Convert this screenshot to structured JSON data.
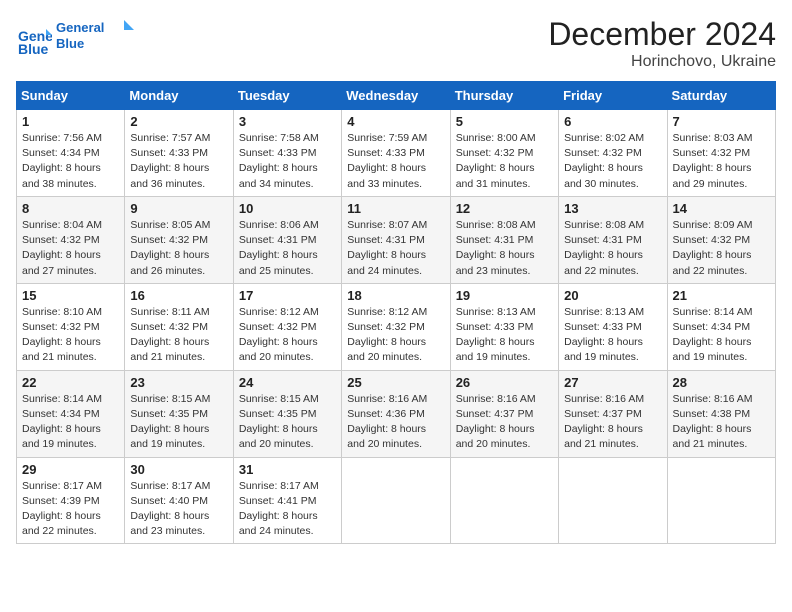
{
  "header": {
    "logo_line1": "General",
    "logo_line2": "Blue",
    "month_title": "December 2024",
    "location": "Horinchovo, Ukraine"
  },
  "weekdays": [
    "Sunday",
    "Monday",
    "Tuesday",
    "Wednesday",
    "Thursday",
    "Friday",
    "Saturday"
  ],
  "weeks": [
    [
      {
        "day": "1",
        "sunrise": "7:56 AM",
        "sunset": "4:34 PM",
        "daylight": "8 hours and 38 minutes."
      },
      {
        "day": "2",
        "sunrise": "7:57 AM",
        "sunset": "4:33 PM",
        "daylight": "8 hours and 36 minutes."
      },
      {
        "day": "3",
        "sunrise": "7:58 AM",
        "sunset": "4:33 PM",
        "daylight": "8 hours and 34 minutes."
      },
      {
        "day": "4",
        "sunrise": "7:59 AM",
        "sunset": "4:33 PM",
        "daylight": "8 hours and 33 minutes."
      },
      {
        "day": "5",
        "sunrise": "8:00 AM",
        "sunset": "4:32 PM",
        "daylight": "8 hours and 31 minutes."
      },
      {
        "day": "6",
        "sunrise": "8:02 AM",
        "sunset": "4:32 PM",
        "daylight": "8 hours and 30 minutes."
      },
      {
        "day": "7",
        "sunrise": "8:03 AM",
        "sunset": "4:32 PM",
        "daylight": "8 hours and 29 minutes."
      }
    ],
    [
      {
        "day": "8",
        "sunrise": "8:04 AM",
        "sunset": "4:32 PM",
        "daylight": "8 hours and 27 minutes."
      },
      {
        "day": "9",
        "sunrise": "8:05 AM",
        "sunset": "4:32 PM",
        "daylight": "8 hours and 26 minutes."
      },
      {
        "day": "10",
        "sunrise": "8:06 AM",
        "sunset": "4:31 PM",
        "daylight": "8 hours and 25 minutes."
      },
      {
        "day": "11",
        "sunrise": "8:07 AM",
        "sunset": "4:31 PM",
        "daylight": "8 hours and 24 minutes."
      },
      {
        "day": "12",
        "sunrise": "8:08 AM",
        "sunset": "4:31 PM",
        "daylight": "8 hours and 23 minutes."
      },
      {
        "day": "13",
        "sunrise": "8:08 AM",
        "sunset": "4:31 PM",
        "daylight": "8 hours and 22 minutes."
      },
      {
        "day": "14",
        "sunrise": "8:09 AM",
        "sunset": "4:32 PM",
        "daylight": "8 hours and 22 minutes."
      }
    ],
    [
      {
        "day": "15",
        "sunrise": "8:10 AM",
        "sunset": "4:32 PM",
        "daylight": "8 hours and 21 minutes."
      },
      {
        "day": "16",
        "sunrise": "8:11 AM",
        "sunset": "4:32 PM",
        "daylight": "8 hours and 21 minutes."
      },
      {
        "day": "17",
        "sunrise": "8:12 AM",
        "sunset": "4:32 PM",
        "daylight": "8 hours and 20 minutes."
      },
      {
        "day": "18",
        "sunrise": "8:12 AM",
        "sunset": "4:32 PM",
        "daylight": "8 hours and 20 minutes."
      },
      {
        "day": "19",
        "sunrise": "8:13 AM",
        "sunset": "4:33 PM",
        "daylight": "8 hours and 19 minutes."
      },
      {
        "day": "20",
        "sunrise": "8:13 AM",
        "sunset": "4:33 PM",
        "daylight": "8 hours and 19 minutes."
      },
      {
        "day": "21",
        "sunrise": "8:14 AM",
        "sunset": "4:34 PM",
        "daylight": "8 hours and 19 minutes."
      }
    ],
    [
      {
        "day": "22",
        "sunrise": "8:14 AM",
        "sunset": "4:34 PM",
        "daylight": "8 hours and 19 minutes."
      },
      {
        "day": "23",
        "sunrise": "8:15 AM",
        "sunset": "4:35 PM",
        "daylight": "8 hours and 19 minutes."
      },
      {
        "day": "24",
        "sunrise": "8:15 AM",
        "sunset": "4:35 PM",
        "daylight": "8 hours and 20 minutes."
      },
      {
        "day": "25",
        "sunrise": "8:16 AM",
        "sunset": "4:36 PM",
        "daylight": "8 hours and 20 minutes."
      },
      {
        "day": "26",
        "sunrise": "8:16 AM",
        "sunset": "4:37 PM",
        "daylight": "8 hours and 20 minutes."
      },
      {
        "day": "27",
        "sunrise": "8:16 AM",
        "sunset": "4:37 PM",
        "daylight": "8 hours and 21 minutes."
      },
      {
        "day": "28",
        "sunrise": "8:16 AM",
        "sunset": "4:38 PM",
        "daylight": "8 hours and 21 minutes."
      }
    ],
    [
      {
        "day": "29",
        "sunrise": "8:17 AM",
        "sunset": "4:39 PM",
        "daylight": "8 hours and 22 minutes."
      },
      {
        "day": "30",
        "sunrise": "8:17 AM",
        "sunset": "4:40 PM",
        "daylight": "8 hours and 23 minutes."
      },
      {
        "day": "31",
        "sunrise": "8:17 AM",
        "sunset": "4:41 PM",
        "daylight": "8 hours and 24 minutes."
      },
      null,
      null,
      null,
      null
    ]
  ]
}
